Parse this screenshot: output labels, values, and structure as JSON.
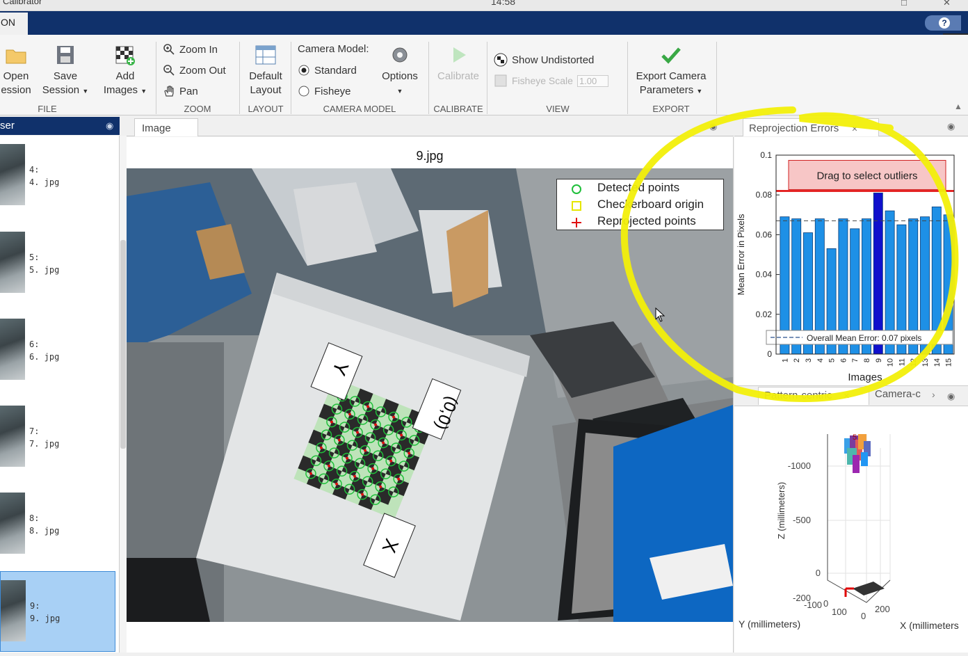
{
  "titlebar": {
    "app_title": "Calibrator",
    "clock": "14:58"
  },
  "ribbon": {
    "tab_label": "ON",
    "file": {
      "section_label": "FILE",
      "open_session": [
        "Open",
        "ession"
      ],
      "save_session": [
        "Save",
        "Session"
      ],
      "add_images": [
        "Add",
        "Images"
      ]
    },
    "zoom": {
      "section_label": "ZOOM",
      "zoom_in": "Zoom In",
      "zoom_out": "Zoom Out",
      "pan": "Pan"
    },
    "layout": {
      "section_label": "LAYOUT",
      "default_layout": [
        "Default",
        "Layout"
      ]
    },
    "camera_model": {
      "section_label": "CAMERA MODEL",
      "label": "Camera Model:",
      "standard": "Standard",
      "fisheye": "Fisheye",
      "selected": "Standard",
      "options": "Options"
    },
    "calibrate": {
      "section_label": "CALIBRATE",
      "calibrate": "Calibrate"
    },
    "view": {
      "section_label": "VIEW",
      "show_undistorted": "Show Undistorted",
      "fisheye_scale_label": "Fisheye Scale",
      "fisheye_scale_value": "1.00"
    },
    "export": {
      "section_label": "EXPORT",
      "export_camera_parameters": [
        "Export Camera",
        "Parameters"
      ]
    }
  },
  "browser": {
    "title": "ser",
    "items": [
      {
        "index": "4:",
        "file": "4. jpg"
      },
      {
        "index": "5:",
        "file": "5. jpg"
      },
      {
        "index": "6:",
        "file": "6. jpg"
      },
      {
        "index": "7:",
        "file": "7. jpg"
      },
      {
        "index": "8:",
        "file": "8. jpg"
      },
      {
        "index": "9:",
        "file": "9. jpg"
      }
    ],
    "selected_file": "9. jpg"
  },
  "image_panel": {
    "tab_label": "Image",
    "title": "9.jpg",
    "legend": {
      "detected": "Detected points",
      "origin": "Checkerboard origin",
      "reprojected": "Reprojected points"
    },
    "axis_labels": {
      "y": "Y",
      "x": "X",
      "origin": "(0,0)"
    }
  },
  "reprojection_panel": {
    "tab_label": "Reprojection Errors",
    "drag_label": "Drag to select outliers",
    "mean_label": "Overall Mean Error: 0.07 pixels"
  },
  "bottom_right": {
    "tab_pattern": "Pattern-centric",
    "tab_camera": "Camera-c",
    "z_label": "Z (millimeters)",
    "y_label": "Y (millimeters)",
    "x_label": "X (millimeters",
    "z_ticks": [
      "-1000",
      "-500",
      "0"
    ],
    "y_ticks": [
      "-200",
      "-100",
      "0",
      "100"
    ],
    "x_ticks": [
      "0",
      "200"
    ],
    "marker": "5"
  },
  "colors": {
    "accent_blue": "#10316b",
    "bar_blue": "#1e90e6",
    "bar_selected": "#1010cc",
    "outlier_line": "#e00000",
    "outlier_box": "#f7c6c6",
    "highlight_yellow": "#f2ef0a",
    "selected_row": "#a8d0f5"
  },
  "chart_data": {
    "type": "bar",
    "title": "",
    "xlabel": "Images",
    "ylabel": "Mean Error in Pixels",
    "ylim": [
      0,
      0.1
    ],
    "yticks": [
      "0",
      "0.02",
      "0.04",
      "0.06",
      "0.08",
      "0.1"
    ],
    "categories": [
      "1",
      "2",
      "3",
      "4",
      "5",
      "6",
      "7",
      "8",
      "9",
      "10",
      "11",
      "12",
      "13",
      "14",
      "15"
    ],
    "values": [
      0.069,
      0.068,
      0.061,
      0.068,
      0.053,
      0.068,
      0.063,
      0.068,
      0.081,
      0.072,
      0.065,
      0.068,
      0.069,
      0.074,
      0.07
    ],
    "selected_index": 8,
    "mean_error": 0.067,
    "outlier_threshold": 0.082
  }
}
